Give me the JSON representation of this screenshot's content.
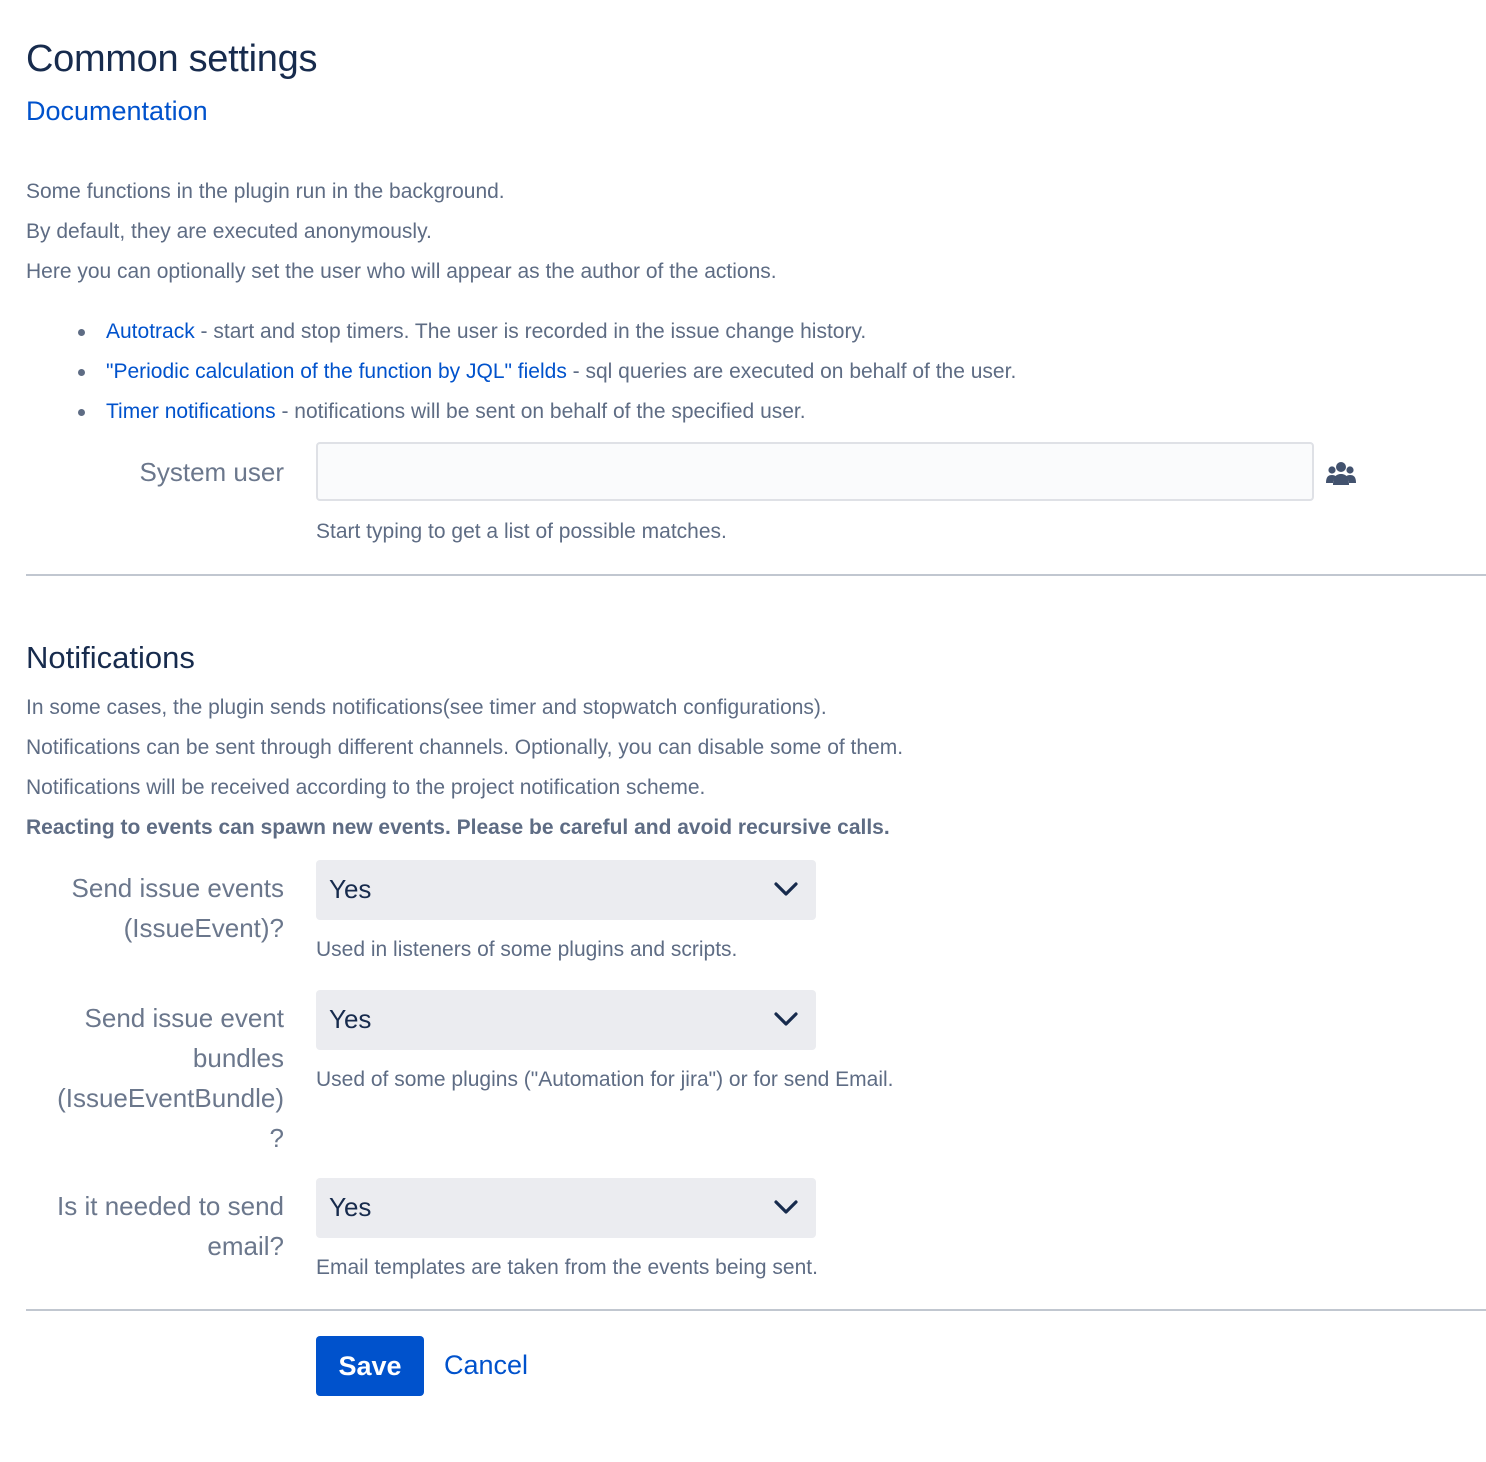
{
  "header": {
    "title": "Common settings",
    "documentation_link": "Documentation"
  },
  "intro": {
    "lines": [
      "Some functions in the plugin run in the background.",
      "By default, they are executed anonymously.",
      "Here you can optionally set the user who will appear as the author of the actions."
    ],
    "bullets": [
      {
        "link": "Autotrack",
        "text": " - start and stop timers. The user is recorded in the issue change history."
      },
      {
        "link": "\"Periodic calculation of the function by JQL\" fields",
        "text": " - sql queries are executed on behalf of the user."
      },
      {
        "link": "Timer notifications",
        "text": " - notifications will be sent on behalf of the specified user."
      }
    ]
  },
  "system_user": {
    "label": "System user",
    "value": "",
    "hint": "Start typing to get a list of possible matches.",
    "icon": "users-icon"
  },
  "notifications": {
    "title": "Notifications",
    "lines": [
      "In some cases, the plugin sends notifications(see timer and stopwatch configurations).",
      "Notifications can be sent through different channels. Optionally, you can disable some of them.",
      "Notifications will be received according to the project notification scheme."
    ],
    "warning": "Reacting to events can spawn new events. Please be careful and avoid recursive calls.",
    "fields": [
      {
        "label_lines": [
          "Send issue events",
          "(IssueEvent)?"
        ],
        "value": "Yes",
        "hint": "Used in listeners of some plugins and scripts."
      },
      {
        "label_lines": [
          "Send issue event",
          "bundles",
          "(IssueEventBundle)",
          "?"
        ],
        "value": "Yes",
        "hint": "Used of some plugins (\"Automation for jira\") or for send Email."
      },
      {
        "label_lines": [
          "Is it needed to send",
          "email?"
        ],
        "value": "Yes",
        "hint": "Email templates are taken from the events being sent."
      }
    ]
  },
  "actions": {
    "save_label": "Save",
    "cancel_label": "Cancel"
  },
  "colors": {
    "link": "#0052cc",
    "primary_button": "#0052cc",
    "heading": "#172b4d",
    "text": "#5e6c84",
    "select_bg": "#ebecf0"
  }
}
